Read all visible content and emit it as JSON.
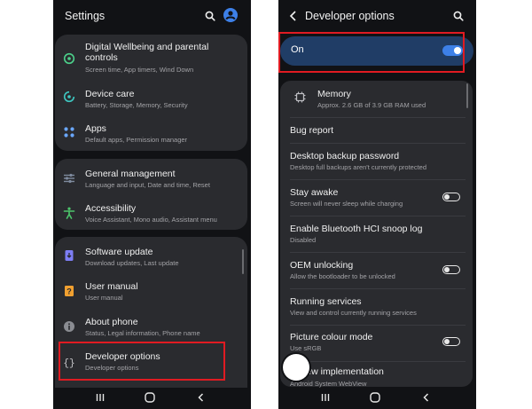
{
  "left": {
    "title": "Settings",
    "card1": [
      {
        "title": "Digital Wellbeing and parental controls",
        "title_line1": "Digital Wellbeing and parental",
        "title_line2": "controls",
        "subtitle": "Screen time, App timers, Wind Down",
        "icon": "digital-wellbeing-icon"
      },
      {
        "title": "Device care",
        "subtitle": "Battery, Storage, Memory, Security",
        "icon": "device-care-icon"
      },
      {
        "title": "Apps",
        "subtitle": "Default apps, Permission manager",
        "icon": "apps-icon"
      }
    ],
    "card2": [
      {
        "title": "General management",
        "subtitle": "Language and input, Date and time, Reset",
        "icon": "general-management-icon"
      },
      {
        "title": "Accessibility",
        "subtitle": "Voice Assistant, Mono audio, Assistant menu",
        "icon": "accessibility-icon"
      }
    ],
    "card3": [
      {
        "title": "Software update",
        "subtitle": "Download updates, Last update",
        "icon": "software-update-icon"
      },
      {
        "title": "User manual",
        "subtitle": "User manual",
        "icon": "user-manual-icon"
      },
      {
        "title": "About phone",
        "subtitle": "Status, Legal information, Phone name",
        "icon": "info-icon"
      },
      {
        "title": "Developer options",
        "subtitle": "Developer options",
        "icon": "developer-options-icon"
      }
    ]
  },
  "right": {
    "title": "Developer options",
    "master_switch": {
      "label": "On",
      "state": true
    },
    "items": [
      {
        "title": "Memory",
        "subtitle": "Approx. 2.6 GB of 3.9 GB RAM used",
        "icon": "memory-icon"
      },
      {
        "title": "Bug report",
        "subtitle": ""
      },
      {
        "title": "Desktop backup password",
        "subtitle": "Desktop full backups aren't currently protected"
      },
      {
        "title": "Stay awake",
        "subtitle": "Screen will never sleep while charging",
        "toggle": false
      },
      {
        "title": "Enable Bluetooth HCI snoop log",
        "subtitle": "Disabled"
      },
      {
        "title": "OEM unlocking",
        "subtitle": "Allow the bootloader to be unlocked",
        "toggle": false
      },
      {
        "title": "Running services",
        "subtitle": "View and control currently running services"
      },
      {
        "title": "Picture colour mode",
        "subtitle": "Use sRGB",
        "toggle": false
      },
      {
        "title": "View implementation",
        "title_visible": "iew implementation",
        "subtitle": "Android System WebView"
      }
    ]
  },
  "colors": {
    "background": "#111215",
    "card": "#2a2b2f",
    "accent_blue": "#3d80e8",
    "switch_bar": "#203d66",
    "highlight_red": "#e01b22",
    "subtitle_gray": "#a3a3a7"
  }
}
